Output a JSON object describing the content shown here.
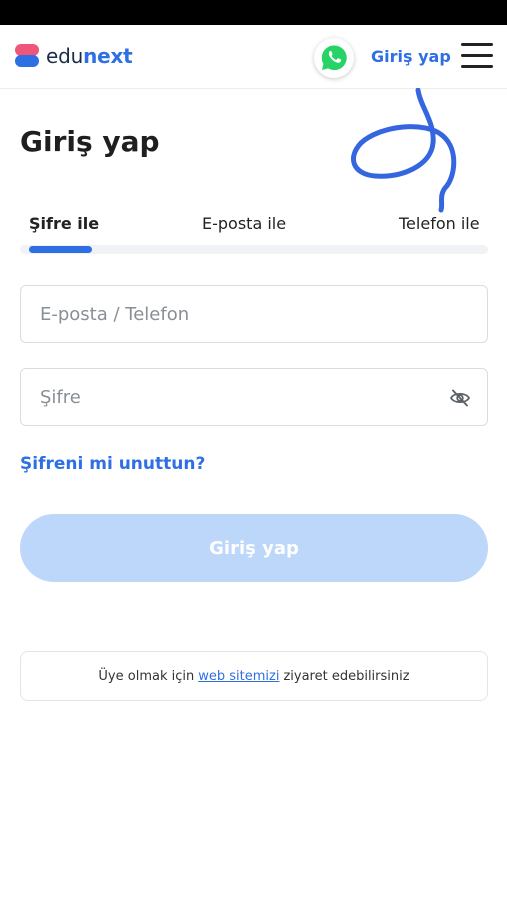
{
  "header": {
    "logo_part1": "edu",
    "logo_part2": "next",
    "whatsapp_icon": "whatsapp-icon",
    "login_link": "Giriş yap",
    "menu_icon": "hamburger-menu-icon"
  },
  "page": {
    "title": "Giriş yap"
  },
  "tabs": [
    {
      "label": "Şifre ile",
      "active": true
    },
    {
      "label": "E-posta ile",
      "active": false
    },
    {
      "label": "Telefon ile",
      "active": false
    }
  ],
  "form": {
    "identifier_placeholder": "E-posta / Telefon",
    "identifier_value": "",
    "password_placeholder": "Şifre",
    "password_value": "",
    "password_toggle_icon": "eye-off-icon",
    "forgot_link": "Şifreni mi unuttun?",
    "submit_label": "Giriş yap"
  },
  "footer_info": {
    "text_before": "Üye olmak için",
    "link": "web sitemizi",
    "text_after": "ziyaret edebilirsiniz"
  },
  "colors": {
    "brand_blue": "#2f6fe4",
    "brand_pink": "#f0567a",
    "button_disabled": "#bdd7fb",
    "whatsapp_green": "#25d366"
  }
}
